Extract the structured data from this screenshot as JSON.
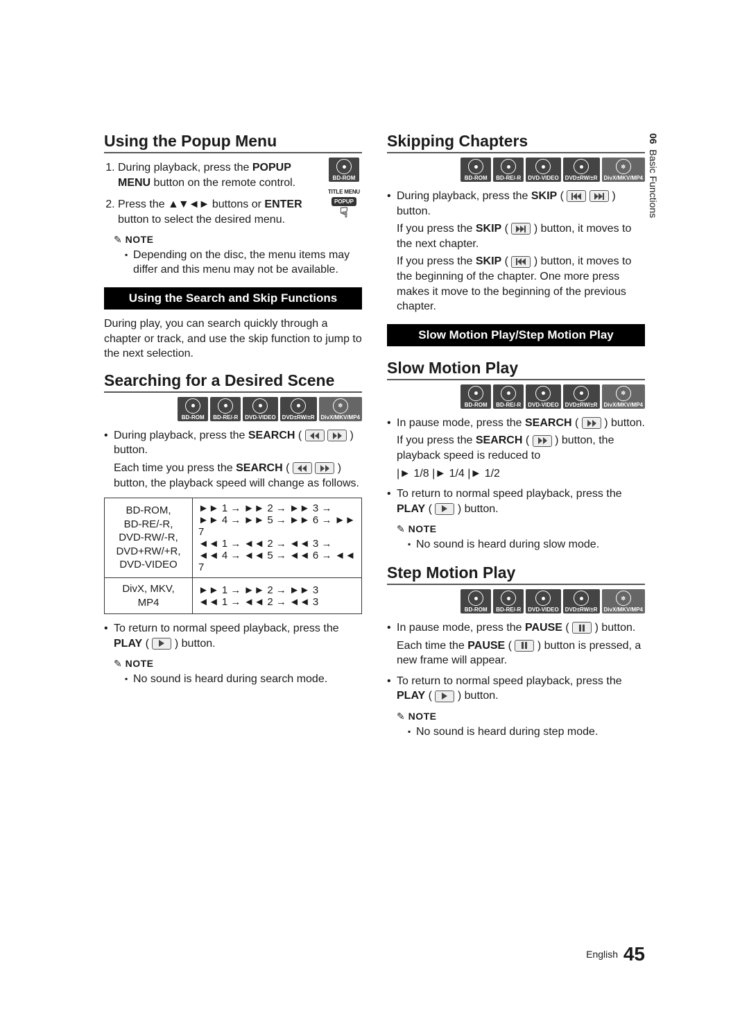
{
  "side": {
    "chapter": "06",
    "title": "Basic Functions"
  },
  "footer": {
    "lang": "English",
    "page": "45"
  },
  "left": {
    "h_popup": "Using the Popup Menu",
    "popup_disc": "BD-ROM",
    "popup_title_menu": "TITLE MENU",
    "popup_btn": "POPUP",
    "step1_a": "During playback, press the ",
    "step1_b": "POPUP MENU",
    "step1_c": " button on the remote control.",
    "step2_a": "Press the ",
    "step2_arrows": "▲▼◄►",
    "step2_b": " buttons or ",
    "step2_enter": "ENTER",
    "step2_c": " button to select the desired menu.",
    "note": "NOTE",
    "note1": "Depending on the disc, the menu items may differ and this menu may not be available.",
    "bar": "Using the Search and Skip Functions",
    "intro": "During play, you can search quickly through a chapter or track, and use the skip function to jump to the next selection.",
    "h_search": "Searching for a Desired Scene",
    "discs": [
      "BD-ROM",
      "BD-RE/-R",
      "DVD-VIDEO",
      "DVD±RW/±R",
      "DivX/MKV/MP4"
    ],
    "srch1_a": "During playback, press the ",
    "srch1_b": "SEARCH",
    "srch1_c": " ( ",
    "srch1_d": " ) button.",
    "srch2_a": "Each time you press the ",
    "srch2_b": "SEARCH",
    "srch2_c": " ( ",
    "srch2_d": " ) button, the playback speed will change as follows.",
    "tbl": {
      "r1_label": "BD-ROM,\nBD-RE/-R,\nDVD-RW/-R,\nDVD+RW/+R,\nDVD-VIDEO",
      "r1_val": "►► 1 → ►► 2 → ►► 3 →\n►► 4 → ►► 5 → ►► 6 → ►► 7\n◄◄ 1 → ◄◄ 2 → ◄◄ 3 →\n◄◄ 4 → ◄◄ 5 → ◄◄ 6 → ◄◄ 7",
      "r2_label": "DivX, MKV, MP4",
      "r2_val": "►► 1 → ►► 2 → ►► 3\n◄◄ 1 → ◄◄ 2 → ◄◄ 3"
    },
    "ret_a": "To return to normal speed playback, press the ",
    "ret_b": "PLAY",
    "ret_c": " ( ",
    "ret_d": " ) button.",
    "note2": "No sound is heard during search mode."
  },
  "right": {
    "h_skip": "Skipping Chapters",
    "discs": [
      "BD-ROM",
      "BD-RE/-R",
      "DVD-VIDEO",
      "DVD±RW/±R",
      "DivX/MKV/MP4"
    ],
    "skip1_a": "During playback, press the ",
    "skip1_b": "SKIP",
    "skip1_c": " ( ",
    "skip1_d": " ) button.",
    "skip2_a": "If you press the ",
    "skip2_b": "SKIP",
    "skip2_c": " ( ",
    "skip2_d": " ) button, it moves to the next chapter.",
    "skip3_a": "If you press the ",
    "skip3_b": "SKIP",
    "skip3_c": " ( ",
    "skip3_d": " ) button, it moves to the beginning of the chapter. One more press makes it move to the beginning of the previous chapter.",
    "bar": "Slow Motion Play/Step Motion Play",
    "h_slow": "Slow Motion Play",
    "slow1_a": "In pause mode, press the ",
    "slow1_b": "SEARCH",
    "slow1_c": " ( ",
    "slow1_d": " ) button.",
    "slow2_a": "If you press the ",
    "slow2_b": "SEARCH",
    "slow2_c": " ( ",
    "slow2_d": " ) button, the playback speed is reduced to",
    "slow_speeds": "|► 1/8  |► 1/4  |► 1/2",
    "slow_ret_a": "To return to normal speed playback, press the ",
    "slow_ret_b": "PLAY",
    "slow_ret_c": " ( ",
    "slow_ret_d": " ) button.",
    "note": "NOTE",
    "slow_note": "No sound is heard during slow mode.",
    "h_step": "Step Motion Play",
    "step1_a": "In pause mode, press the ",
    "step1_b": "PAUSE",
    "step1_c": " ( ",
    "step1_d": " ) button.",
    "step2_a": "Each time the ",
    "step2_b": "PAUSE",
    "step2_c": " ( ",
    "step2_d": " ) button is pressed, a new frame will appear.",
    "step_ret_a": "To return to normal speed playback, press the ",
    "step_ret_b": "PLAY",
    "step_ret_c": " ( ",
    "step_ret_d": " ) button.",
    "step_note": "No sound is heard during step mode."
  }
}
